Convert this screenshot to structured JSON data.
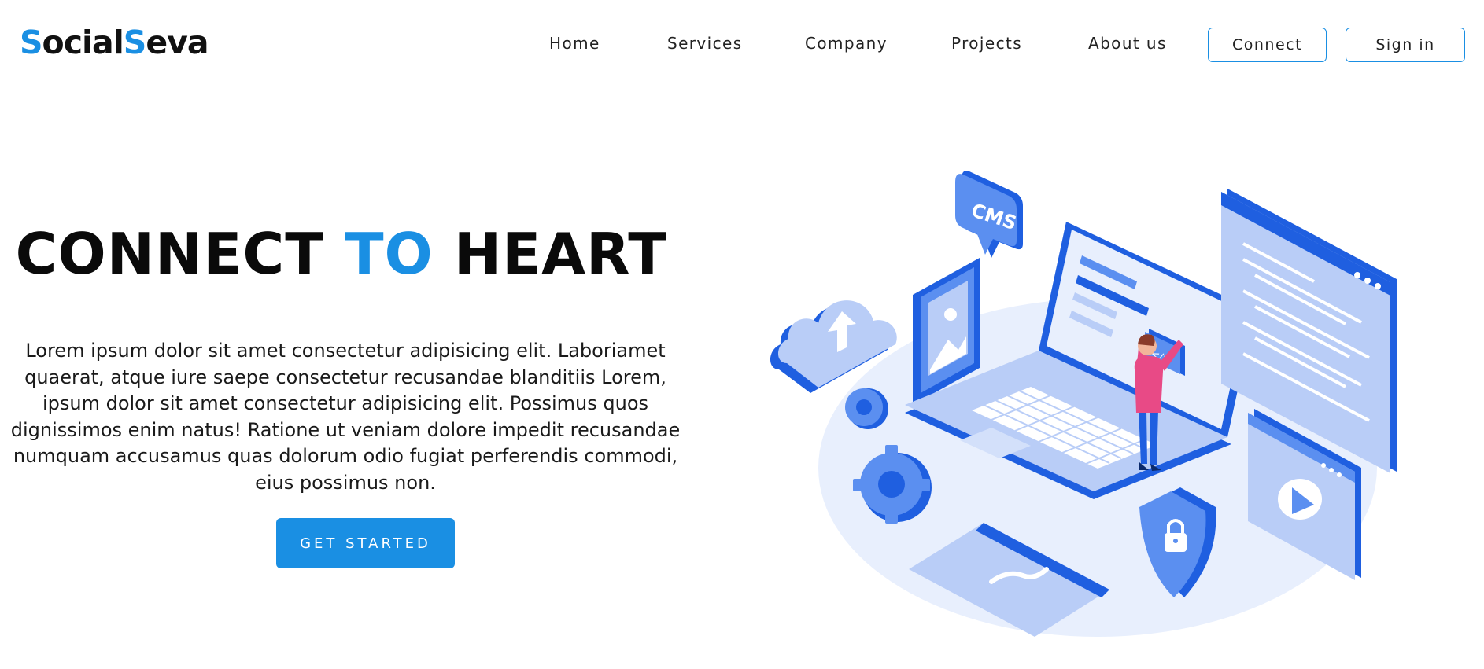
{
  "brand": {
    "part1_initial": "S",
    "part1_rest": "ocial",
    "part2_initial": "S",
    "part2_rest": "eva"
  },
  "nav": {
    "items": [
      {
        "label": "Home"
      },
      {
        "label": "Services"
      },
      {
        "label": "Company"
      },
      {
        "label": "Projects"
      },
      {
        "label": "About us"
      }
    ],
    "connect_label": "Connect",
    "signin_label": "Sign in"
  },
  "hero": {
    "title_part1": "CONNECT ",
    "title_accent": "TO",
    "title_part2": " HEART",
    "description": "Lorem ipsum dolor sit amet consectetur adipisicing elit. Laboriamet quaerat, atque iure saepe consectetur recusandae blanditiis Lorem, ipsum dolor sit amet consectetur adipisicing elit. Possimus quos dignissimos enim natus! Ratione ut veniam dolore impedit recusandae numquam accusamus quas dolorum odio fugiat perferendis commodi, eius possimus non.",
    "cta_label": "GET STARTED"
  },
  "illustration": {
    "cms_label": "CMS",
    "code_label": "</>",
    "icons": [
      "cloud-upload-icon",
      "image-icon",
      "cms-bubble-icon",
      "laptop-icon",
      "gear-icon",
      "shield-lock-icon",
      "video-window-icon",
      "code-window-icon",
      "card-icon"
    ]
  },
  "colors": {
    "accent": "#1a8fe3",
    "illustration_dark": "#1f5fe0",
    "illustration_mid": "#5b8ff0",
    "illustration_light": "#b9cdf7",
    "illustration_pale": "#e8effd",
    "figure_pink": "#e84a86"
  }
}
